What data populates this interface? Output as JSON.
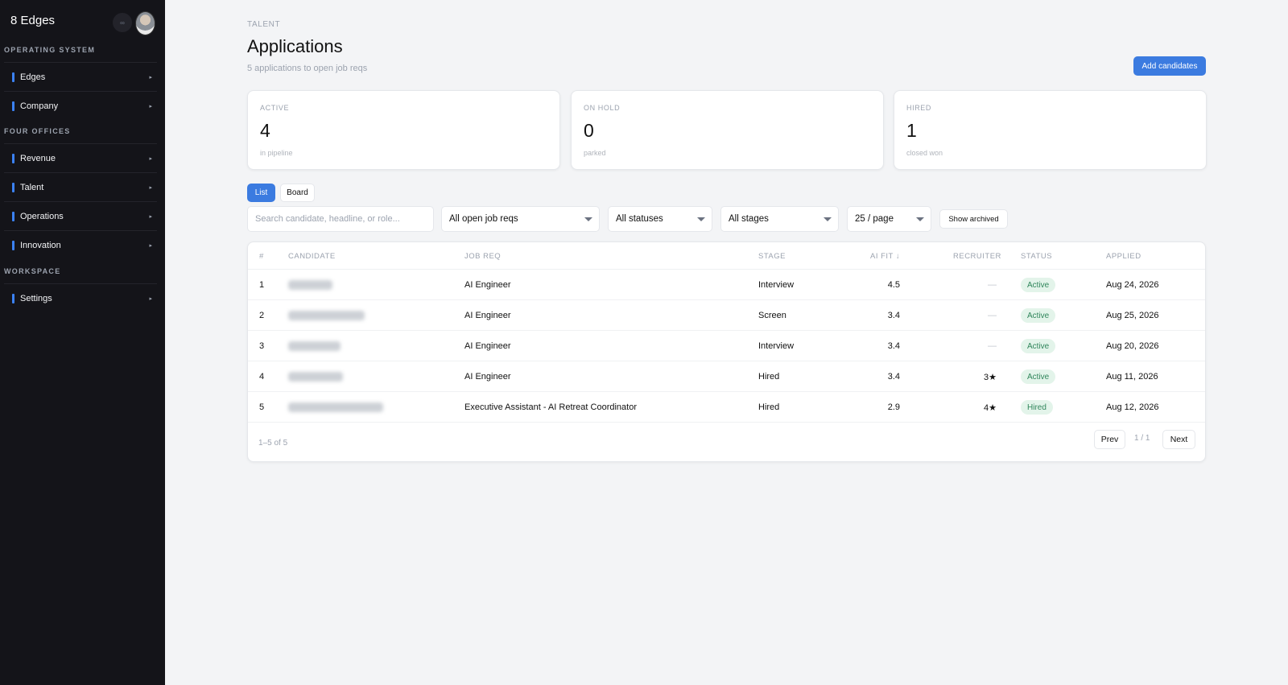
{
  "sidebar": {
    "brand": "8 Edges",
    "pill": "∞",
    "sections": [
      {
        "title": "OPERATING SYSTEM",
        "items": [
          {
            "label": "Edges"
          },
          {
            "label": "Company"
          }
        ]
      },
      {
        "title": "FOUR OFFICES",
        "items": [
          {
            "label": "Revenue"
          },
          {
            "label": "Talent"
          },
          {
            "label": "Operations"
          },
          {
            "label": "Innovation"
          }
        ]
      },
      {
        "title": "WORKSPACE",
        "items": [
          {
            "label": "Settings"
          }
        ]
      }
    ],
    "chevron": "▸"
  },
  "header": {
    "eyebrow": "TALENT",
    "title": "Applications",
    "subtitle": "5 applications to open job reqs",
    "add_button": "Add candidates"
  },
  "stats": [
    {
      "label": "ACTIVE",
      "value": "4",
      "sub": "in pipeline"
    },
    {
      "label": "ON HOLD",
      "value": "0",
      "sub": "parked"
    },
    {
      "label": "HIRED",
      "value": "1",
      "sub": "closed won"
    }
  ],
  "view_tabs": {
    "list": "List",
    "board": "Board"
  },
  "filters": {
    "search_placeholder": "Search candidate, headline, or role...",
    "job_reqs": "All open job reqs",
    "statuses": "All statuses",
    "stages": "All stages",
    "per_page": "25 / page",
    "show_archived": "Show archived"
  },
  "table": {
    "columns": {
      "num": "#",
      "candidate": "CANDIDATE",
      "job_req": "JOB REQ",
      "stage": "STAGE",
      "ai_fit": "AI FIT ↓",
      "recruiter": "RECRUITER",
      "status": "STATUS",
      "applied": "APPLIED"
    },
    "rows": [
      {
        "num": "1",
        "job_req": "AI Engineer",
        "stage": "Interview",
        "ai_fit": "4.5",
        "recruiter": "—",
        "status": "Active",
        "applied": "Aug 24, 2026"
      },
      {
        "num": "2",
        "job_req": "AI Engineer",
        "stage": "Screen",
        "ai_fit": "3.4",
        "recruiter": "—",
        "status": "Active",
        "applied": "Aug 25, 2026"
      },
      {
        "num": "3",
        "job_req": "AI Engineer",
        "stage": "Interview",
        "ai_fit": "3.4",
        "recruiter": "—",
        "status": "Active",
        "applied": "Aug 20, 2026"
      },
      {
        "num": "4",
        "job_req": "AI Engineer",
        "stage": "Hired",
        "ai_fit": "3.4",
        "recruiter": "3★",
        "status": "Active",
        "applied": "Aug 11, 2026"
      },
      {
        "num": "5",
        "job_req": "Executive Assistant - AI Retreat Coordinator",
        "stage": "Hired",
        "ai_fit": "2.9",
        "recruiter": "4★",
        "status": "Hired",
        "applied": "Aug 12, 2026"
      }
    ],
    "footer": {
      "info": "1–5 of 5",
      "prev": "Prev",
      "page": "1 / 1",
      "next": "Next"
    }
  }
}
